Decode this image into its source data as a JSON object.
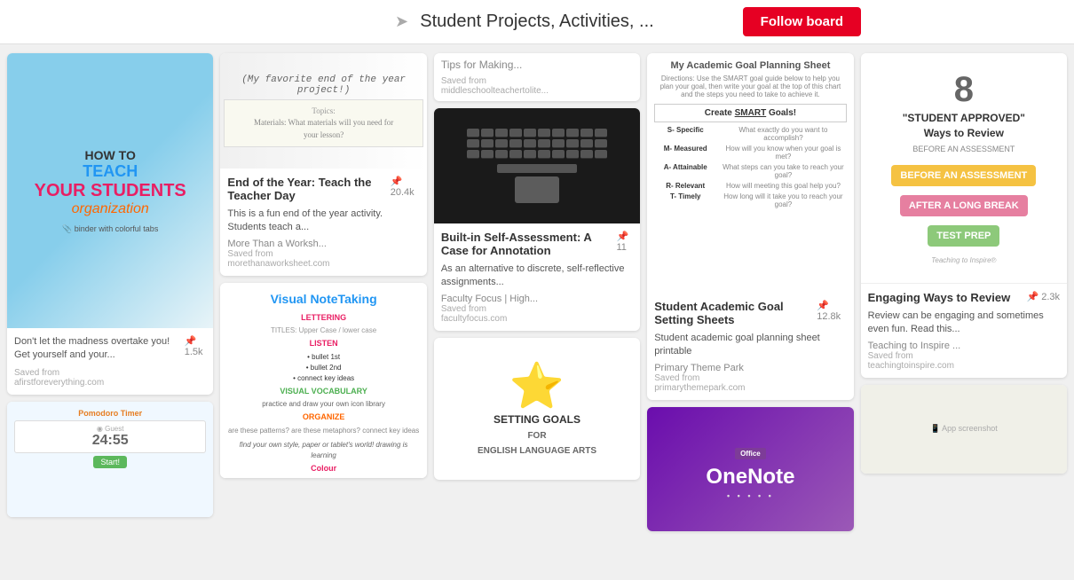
{
  "header": {
    "title": "Student Projects, Activities, ...",
    "follow_label": "Follow board"
  },
  "columns": [
    {
      "id": "col1",
      "cards": [
        {
          "id": "teach-org",
          "type": "image-text",
          "image_type": "teach",
          "desc": "Don't let the madness overtake you! Get yourself and your...",
          "count": "1.5k",
          "source": "Saved from",
          "source_url": "afirstforeverything.com"
        },
        {
          "id": "pomodoro",
          "type": "image-text",
          "image_type": "pomodoro",
          "desc": "",
          "count": "",
          "source": "",
          "source_url": ""
        }
      ]
    },
    {
      "id": "col2",
      "cards": [
        {
          "id": "end-of-year",
          "type": "full",
          "image_type": "notebook",
          "title": "End of the Year: Teach the Teacher Day",
          "caption": "(My favorite end of the year project!)",
          "desc": "This is a fun end of the year activity. Students teach a...",
          "count": "20.4k",
          "source_name": "More Than a Worksh...",
          "source": "Saved from",
          "source_url": "morethanaworksheet.com"
        },
        {
          "id": "visual-notetaking",
          "type": "image-only",
          "image_type": "visual-notes"
        }
      ]
    },
    {
      "id": "col3",
      "cards": [
        {
          "id": "tips-making",
          "type": "header-only",
          "header": "Tips for Making...",
          "source": "Saved from",
          "source_url": "middleschoolteachertolite..."
        },
        {
          "id": "self-assessment",
          "type": "full",
          "image_type": "keyboard",
          "title": "Built-in Self-Assessment: A Case for Annotation",
          "desc": "As an alternative to discrete, self-reflective assignments...",
          "count": "11",
          "source_name": "Faculty Focus | High...",
          "source": "Saved from",
          "source_url": "facultyfocus.com"
        },
        {
          "id": "setting-goals-ela",
          "type": "image-only",
          "image_type": "goals-ela"
        }
      ]
    },
    {
      "id": "col4",
      "cards": [
        {
          "id": "academic-goals",
          "type": "full",
          "image_type": "smart",
          "title": "Student Academic Goal Setting Sheets",
          "desc": "Student academic goal planning sheet printable",
          "count": "12.8k",
          "source_name": "Primary Theme Park",
          "source": "Saved from",
          "source_url": "primarythemepark.com"
        },
        {
          "id": "onenote",
          "type": "image-only",
          "image_type": "onenote"
        }
      ]
    },
    {
      "id": "col5",
      "cards": [
        {
          "id": "engaging-review",
          "type": "full",
          "image_type": "review",
          "title": "Engaging Ways to Review",
          "desc": "Review can be engaging and sometimes even fun. Read this...",
          "count": "2.3k",
          "source_name": "Teaching to Inspire ...",
          "source": "Saved from",
          "source_url": "teachingtoinspire.com"
        },
        {
          "id": "extra",
          "type": "image-only",
          "image_type": "extra"
        }
      ]
    }
  ]
}
